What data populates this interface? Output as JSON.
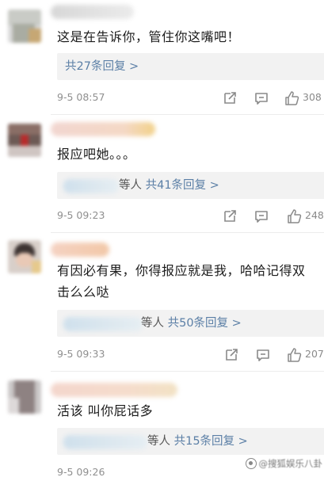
{
  "comments": [
    {
      "text_lines": [
        "这是在告诉你，管住你这嘴吧！"
      ],
      "reply": {
        "prefix": "",
        "link": "共27条回复 >"
      },
      "time": "9-5 08:57",
      "likes": "308"
    },
    {
      "text_lines": [
        "报应吧她。。。"
      ],
      "reply": {
        "prefix": "等人",
        "link": "共41条回复 >"
      },
      "time": "9-5 09:23",
      "likes": "248"
    },
    {
      "text_lines": [
        "有因必有果，你得报应就是我，哈哈记得双",
        "击么么哒"
      ],
      "reply": {
        "prefix": "等人",
        "link": "共50条回复 >"
      },
      "time": "9-5 09:33",
      "likes": "207"
    },
    {
      "text_lines": [
        "活该 叫你屁话多"
      ],
      "reply": {
        "prefix": "等人",
        "link": "共15条回复 >"
      },
      "time": "9-5 09:26",
      "likes": ""
    }
  ],
  "icons": {
    "share": "share-icon",
    "comment": "comment-icon",
    "like": "thumbs-up-icon"
  },
  "colors": {
    "link": "#5b7fa6",
    "reply_bg": "#f2f2f2",
    "meta_gray": "#8f8f8f"
  },
  "watermark": {
    "text": "@搜狐娱乐八卦"
  }
}
